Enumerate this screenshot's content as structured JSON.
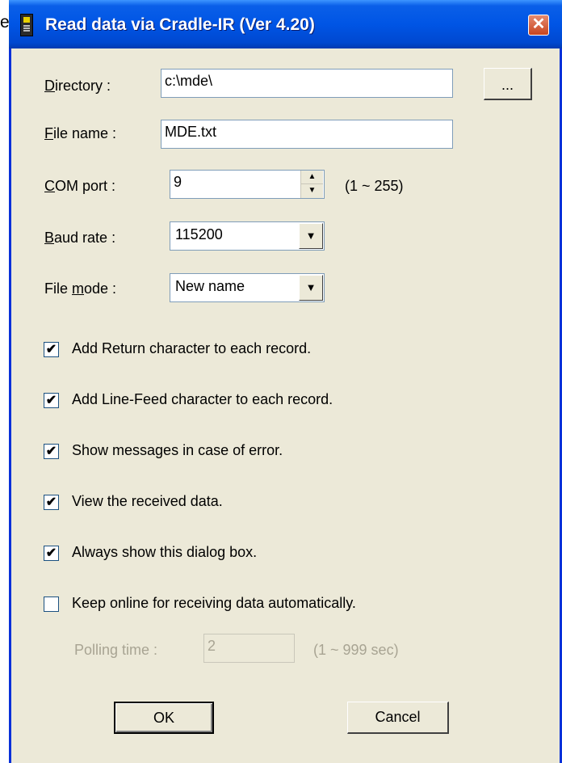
{
  "stray_text": "e",
  "window": {
    "title": "Read data via Cradle-IR (Ver 4.20)"
  },
  "title_bar": {
    "close_label": "✕"
  },
  "directory": {
    "label": "Directory :",
    "value": "c:\\mde\\",
    "browse_label": "..."
  },
  "file_name": {
    "label": "File name :",
    "value": "MDE.txt"
  },
  "com_port": {
    "label": "COM port :",
    "value": "9",
    "range": "(1 ~ 255)"
  },
  "baud_rate": {
    "label": "Baud rate :",
    "selected": "115200"
  },
  "file_mode": {
    "label": "File mode :",
    "selected": "New name"
  },
  "checkboxes": [
    {
      "label": "Add Return character to each record.",
      "checked": true
    },
    {
      "label": "Add Line-Feed character to each record.",
      "checked": true
    },
    {
      "label": "Show messages in case of error.",
      "checked": true
    },
    {
      "label": "View the received data.",
      "checked": true
    },
    {
      "label": "Always show this dialog box.",
      "checked": true
    },
    {
      "label": "Keep online for receiving data automatically.",
      "checked": false
    }
  ],
  "polling": {
    "label": "Polling time :",
    "value": "2",
    "range": "(1 ~ 999 sec)"
  },
  "buttons": {
    "ok": "OK",
    "cancel": "Cancel"
  },
  "colors": {
    "titlebar": "#0055e5",
    "dialog_bg": "#ece9d8",
    "close": "#c8451f"
  }
}
